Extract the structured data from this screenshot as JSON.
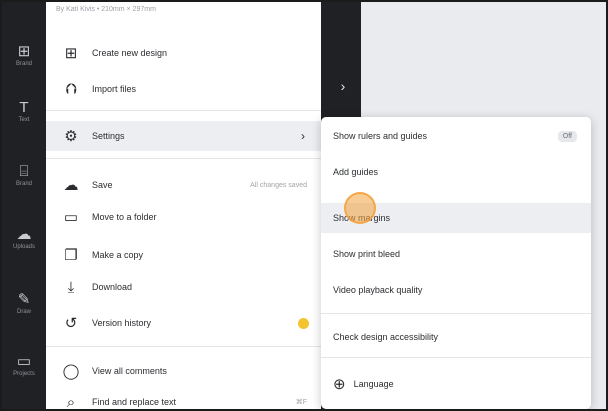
{
  "byline": "By Kati Kivis • 210mm × 297mm",
  "rail": {
    "items": [
      {
        "glyph": "⊞",
        "caption": "Brand"
      },
      {
        "glyph": "T",
        "caption": "Text"
      },
      {
        "glyph": "⌸",
        "caption": "Brand"
      },
      {
        "glyph": "☁",
        "caption": "Uploads"
      },
      {
        "glyph": "✎",
        "caption": "Draw"
      },
      {
        "glyph": "▭",
        "caption": "Projects"
      }
    ]
  },
  "menu": {
    "create_new_design": "Create new design",
    "import_files": "Import files",
    "settings": "Settings",
    "save": "Save",
    "save_status": "All changes saved",
    "move_to_folder": "Move to a folder",
    "make_copy": "Make a copy",
    "download": "Download",
    "version_history": "Version history",
    "view_all_comments": "View all comments",
    "find_replace": "Find and replace text",
    "find_shortcut": "⌘F"
  },
  "submenu": {
    "show_rulers": "Show rulers and guides",
    "show_rulers_toggle": "Off",
    "add_guides": "Add guides",
    "show_margins": "Show margins",
    "show_print_bleed": "Show print bleed",
    "video_playback": "Video playback quality",
    "check_accessibility": "Check design accessibility",
    "language": "Language"
  },
  "colors": {
    "rail": "#1f2125",
    "highlight": "#eceef1",
    "cursor_ring": "#f3a23c",
    "badge": "#f4c430"
  }
}
